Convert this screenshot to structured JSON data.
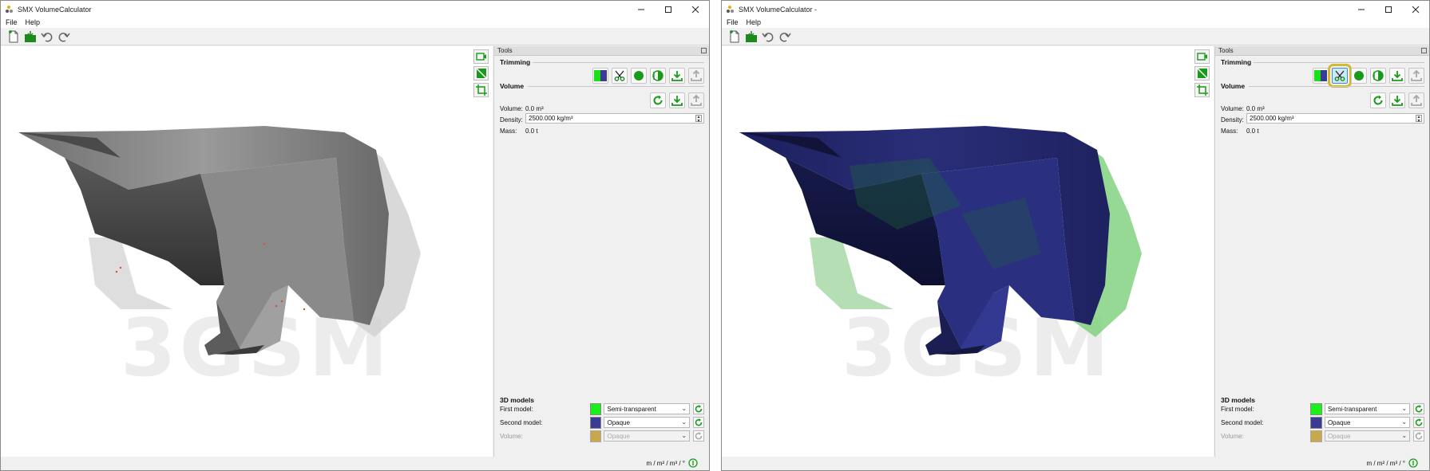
{
  "windows": [
    {
      "title": "SMX VolumeCalculator",
      "menu": [
        "File",
        "Help"
      ],
      "panel_title": "Tools",
      "trimming": {
        "label": "Trimming",
        "highlighted_button": "none"
      },
      "volume_section": {
        "label": "Volume"
      },
      "stats": {
        "volume_label": "Volume:",
        "volume_value": "0.0 m³",
        "density_label": "Density:",
        "density_value": "2500.000 kg/m³",
        "mass_label": "Mass:",
        "mass_value": "0.0 t"
      },
      "models": {
        "heading": "3D models",
        "first_label": "First model:",
        "first_value": "Semi-transparent",
        "first_color": "#19f019",
        "second_label": "Second model:",
        "second_value": "Opaque",
        "second_color": "#3a3c94",
        "volume_label": "Volume:",
        "volume_value": "Opaque",
        "volume_color": "#c8a84c"
      },
      "units": "m / m² / m³ / °",
      "watermark": "3GSM",
      "render_mode": "textured"
    },
    {
      "title": "SMX VolumeCalculator -",
      "menu": [
        "File",
        "Help"
      ],
      "panel_title": "Tools",
      "trimming": {
        "label": "Trimming",
        "highlighted_button": "scissors"
      },
      "volume_section": {
        "label": "Volume"
      },
      "stats": {
        "volume_label": "Volume:",
        "volume_value": "0.0 m³",
        "density_label": "Density:",
        "density_value": "2500.000 kg/m³",
        "mass_label": "Mass:",
        "mass_value": "0.0 t"
      },
      "models": {
        "heading": "3D models",
        "first_label": "First model:",
        "first_value": "Semi-transparent",
        "first_color": "#19f019",
        "second_label": "Second model:",
        "second_value": "Opaque",
        "second_color": "#3a3c94",
        "volume_label": "Volume:",
        "volume_value": "Opaque",
        "volume_color": "#c8a84c"
      },
      "units": "m / m² / m³ / °",
      "watermark": "3GSM",
      "render_mode": "colored"
    }
  ],
  "colors": {
    "accent_green": "#1a9a1a",
    "highlight_box": "#d4b830"
  }
}
